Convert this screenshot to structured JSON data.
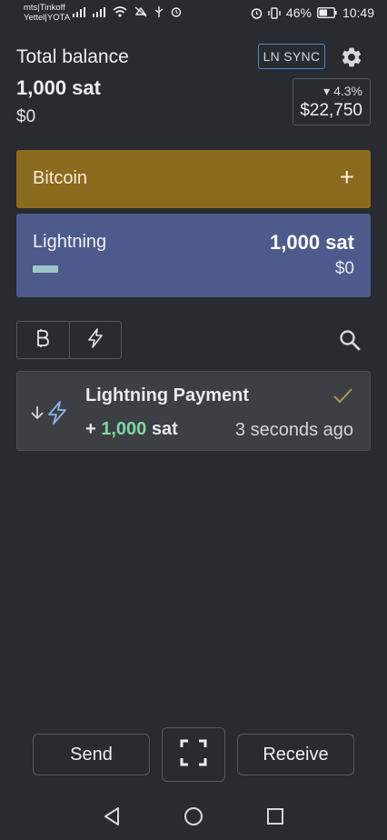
{
  "status_bar": {
    "carrier_line1": "mts|Tinkoff",
    "carrier_line2": "Yettel|YOTA",
    "battery": "46%",
    "time": "10:49",
    "icons": [
      "signal-icon",
      "signal-icon",
      "wifi-icon",
      "mute-icon",
      "usb-icon",
      "alarm-icon",
      "vibrate-icon",
      "battery-icon"
    ]
  },
  "header": {
    "total_label": "Total balance",
    "total_sat": "1,000 sat",
    "total_fiat": "$0",
    "ln_sync": "LN SYNC",
    "settings_icon": "gear-icon",
    "price_change": "▾ 4.3%",
    "price_value": "$22,750"
  },
  "accounts": {
    "bitcoin": {
      "label": "Bitcoin",
      "action": "+",
      "color": "#8c6a1e"
    },
    "lightning": {
      "label": "Lightning",
      "sat": "1,000 sat",
      "fiat": "$0",
      "color": "#4f5a8c"
    }
  },
  "filters": {
    "bitcoin_icon": "bitcoin-icon",
    "lightning_icon": "lightning-icon",
    "search_icon": "search-icon"
  },
  "transactions": [
    {
      "title": "Lightning Payment",
      "amount_prefix": "+ ",
      "amount_value": "1,000",
      "amount_unit": " sat",
      "time": "3 seconds ago",
      "status_icon": "check-icon",
      "direction_icon": "arrow-down-icon",
      "type_icon": "lightning-icon"
    }
  ],
  "actions": {
    "send": "Send",
    "scan_icon": "scan-icon",
    "receive": "Receive"
  },
  "nav": {
    "back_icon": "back-icon",
    "home_icon": "home-icon",
    "recents_icon": "recents-icon"
  }
}
